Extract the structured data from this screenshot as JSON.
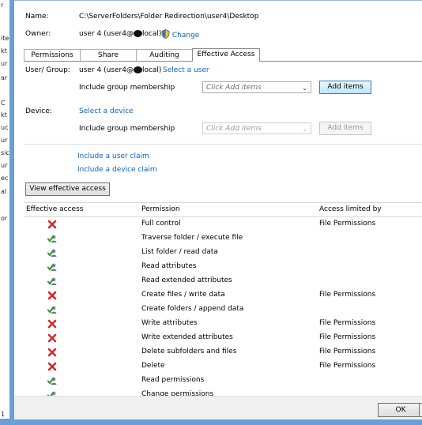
{
  "background_window": {
    "fragments": [
      "r",
      "ite",
      "kt",
      "ur",
      "ar",
      "C",
      "kt",
      "uc",
      "ur",
      "sic",
      "ur",
      "ec",
      "al",
      "or",
      "1"
    ]
  },
  "header": {
    "name_label": "Name:",
    "name_value": "C:\\ServerFolders\\Folder Redirection\\user4\\Desktop",
    "owner_label": "Owner:",
    "owner_value_prefix": "user 4 (user4@",
    "owner_value_suffix": "local)",
    "change_label": "Change"
  },
  "tabs": [
    {
      "label": "Permissions"
    },
    {
      "label": "Share"
    },
    {
      "label": "Auditing"
    },
    {
      "label": "Effective Access"
    }
  ],
  "user_group": {
    "label": "User/ Group:",
    "value_prefix": "user 4 (user4@",
    "value_suffix": "local)",
    "select_link": "Select a user",
    "include_label": "Include group membership",
    "combo_placeholder": "Click Add items",
    "add_items_label": "Add items"
  },
  "device": {
    "label": "Device:",
    "select_link": "Select a device",
    "include_label": "Include group membership",
    "combo_placeholder": "Click Add items",
    "add_items_label": "Add items"
  },
  "claims": {
    "user_claim": "Include a user claim",
    "device_claim": "Include a device claim"
  },
  "view_button": "View effective access",
  "grid": {
    "headers": {
      "effective": "Effective access",
      "permission": "Permission",
      "limited": "Access limited by"
    },
    "rows": [
      {
        "status": "denied",
        "permission": "Full control",
        "limited_by": "File Permissions"
      },
      {
        "status": "allowed",
        "permission": "Traverse folder / execute file",
        "limited_by": ""
      },
      {
        "status": "allowed",
        "permission": "List folder / read data",
        "limited_by": ""
      },
      {
        "status": "allowed",
        "permission": "Read attributes",
        "limited_by": ""
      },
      {
        "status": "allowed",
        "permission": "Read extended attributes",
        "limited_by": ""
      },
      {
        "status": "denied",
        "permission": "Create files / write data",
        "limited_by": "File Permissions"
      },
      {
        "status": "allowed",
        "permission": "Create folders / append data",
        "limited_by": ""
      },
      {
        "status": "denied",
        "permission": "Write attributes",
        "limited_by": "File Permissions"
      },
      {
        "status": "denied",
        "permission": "Write extended attributes",
        "limited_by": "File Permissions"
      },
      {
        "status": "denied",
        "permission": "Delete subfolders and files",
        "limited_by": "File Permissions"
      },
      {
        "status": "denied",
        "permission": "Delete",
        "limited_by": "File Permissions"
      },
      {
        "status": "allowed",
        "permission": "Read permissions",
        "limited_by": ""
      },
      {
        "status": "allowed",
        "permission": "Change permissions",
        "limited_by": ""
      }
    ]
  },
  "footer": {
    "ok_label": "OK"
  },
  "icons": {
    "allowed": "user-check-icon",
    "denied": "red-x-icon",
    "change": "shield-icon"
  },
  "colors": {
    "link": "#0b61c7",
    "deny": "#d8262d",
    "allow": "#3a8f2b",
    "frame": "#6a9fd6"
  }
}
